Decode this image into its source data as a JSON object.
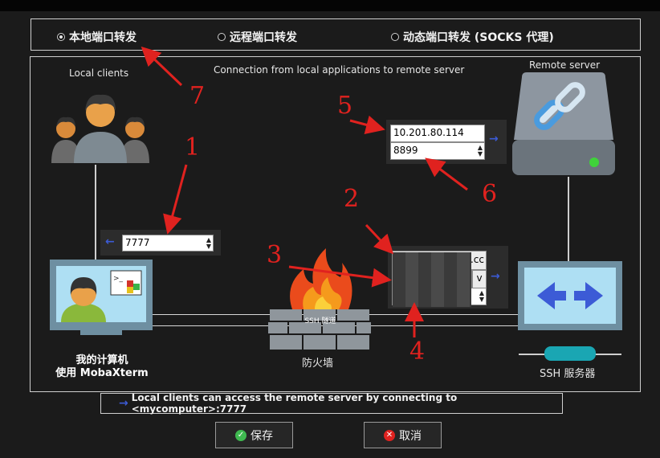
{
  "modes": [
    {
      "label": "本地端口转发",
      "selected": true
    },
    {
      "label": "远程端口转发",
      "selected": false
    },
    {
      "label": "动态端口转发 (SOCKS 代理)",
      "selected": false
    }
  ],
  "diagram": {
    "caption": "Connection from local applications to remote server",
    "local_clients": "Local clients",
    "remote_server": "Remote server",
    "my_computer_line1": "我的计算机",
    "my_computer_line2": "使用 MobaXterm",
    "firewall": "防火墙",
    "ssh_tunnel": "SSH 隧道",
    "ssh_server": "SSH 服务器",
    "local_port": "7777",
    "remote_host": "10.201.80.114",
    "remote_port": "8899",
    "ssh_host_suffix": ".cc",
    "ssh_user_toggle": "v"
  },
  "annotations": [
    "1",
    "2",
    "3",
    "4",
    "5",
    "6",
    "7"
  ],
  "info_text": "Local clients can access the remote server by connecting to <mycomputer>:7777",
  "buttons": {
    "save": "保存",
    "cancel": "取消"
  },
  "colors": {
    "annotation": "#e0221f",
    "accent": "#3c5bd6"
  }
}
